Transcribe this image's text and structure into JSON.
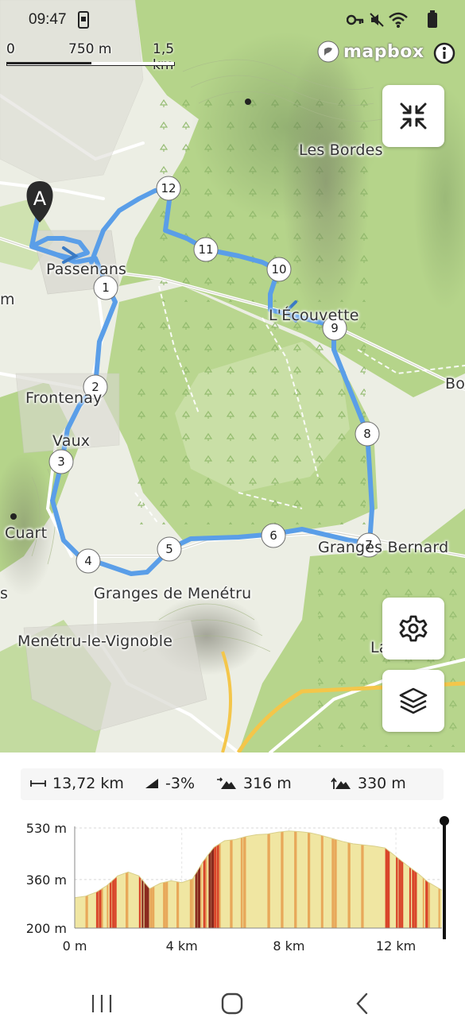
{
  "status_bar": {
    "time": "09:47",
    "icons": [
      "phone-screen-icon",
      "key-icon",
      "mute-icon",
      "wifi-icon",
      "battery-icon"
    ]
  },
  "map": {
    "scale": {
      "labels": [
        "0",
        "750 m",
        "1,5 km"
      ]
    },
    "attribution": "mapbox",
    "start_marker": "A",
    "places": [
      "Les Bordes",
      "Passenans",
      "L'Écouvette",
      "Frontenay",
      "Vaux",
      "Cuart",
      "Granges Bernard",
      "Granges de Menétru",
      "Menétru-le-Vignoble",
      "Bo",
      "La",
      "m",
      "s"
    ],
    "waypoints": [
      "1",
      "2",
      "3",
      "4",
      "5",
      "6",
      "7",
      "8",
      "9",
      "10",
      "11",
      "12"
    ],
    "route_color": "#5a9ee8",
    "forest_color": "#b5d48a"
  },
  "buttons": {
    "collapse": "collapse-icon",
    "settings": "gear-icon",
    "layers": "layers-icon"
  },
  "stats": {
    "distance": "13,72 km",
    "grade": "-3%",
    "descent": "316 m",
    "ascent": "330 m"
  },
  "chart_data": {
    "type": "area",
    "title": "",
    "xlabel": "",
    "ylabel": "",
    "x_ticks": [
      "0 m",
      "4 km",
      "8 km",
      "12 km"
    ],
    "y_ticks": [
      "530 m",
      "360 m",
      "200 m"
    ],
    "xlim": [
      0,
      13.72
    ],
    "ylim": [
      200,
      530
    ],
    "x": [
      0,
      0.4,
      0.8,
      1.2,
      1.6,
      2.0,
      2.4,
      2.8,
      3.2,
      3.6,
      4.0,
      4.4,
      4.8,
      5.2,
      5.6,
      6.0,
      6.4,
      6.8,
      7.2,
      7.6,
      8.0,
      8.4,
      8.8,
      9.2,
      9.6,
      10.0,
      10.4,
      10.8,
      11.2,
      11.6,
      12.0,
      12.4,
      12.8,
      13.2,
      13.72
    ],
    "y": [
      300,
      305,
      318,
      340,
      372,
      385,
      372,
      330,
      348,
      356,
      350,
      362,
      420,
      466,
      488,
      492,
      502,
      508,
      510,
      516,
      520,
      518,
      514,
      506,
      496,
      486,
      478,
      474,
      470,
      464,
      436,
      408,
      382,
      352,
      325
    ],
    "colors": {
      "flat": "#f0e6a2",
      "moderate": "#e8a85a",
      "steep": "#d9452a",
      "very_steep": "#8a2a1e"
    },
    "grid": "dashed"
  },
  "nav_bar": {
    "buttons": [
      "recent-apps-icon",
      "home-icon",
      "back-icon"
    ]
  }
}
